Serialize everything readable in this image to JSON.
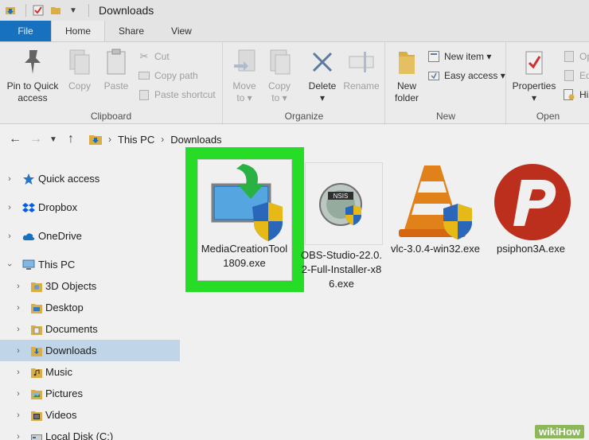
{
  "window": {
    "title": "Downloads"
  },
  "ribbon_tabs": [
    {
      "label": "File"
    },
    {
      "label": "Home"
    },
    {
      "label": "Share"
    },
    {
      "label": "View"
    }
  ],
  "ribbon": {
    "clipboard": {
      "label": "Clipboard",
      "pin_label": "Pin to Quick\naccess",
      "copy_label": "Copy",
      "paste_label": "Paste",
      "cut_label": "Cut",
      "copy_path_label": "Copy path",
      "paste_shortcut_label": "Paste shortcut"
    },
    "organize": {
      "label": "Organize",
      "move_to_label": "Move\nto ▾",
      "copy_to_label": "Copy\nto ▾",
      "delete_label": "Delete\n▾",
      "rename_label": "Rename"
    },
    "new": {
      "label": "New",
      "new_folder_label": "New\nfolder",
      "new_item_label": "New item ▾",
      "easy_access_label": "Easy access ▾"
    },
    "open": {
      "label": "Open",
      "properties_label": "Properties\n▾",
      "op_label": "Op",
      "edi_label": "Edi",
      "his_label": "His"
    }
  },
  "address": {
    "crumbs": [
      "This PC",
      "Downloads"
    ]
  },
  "sidebar": {
    "items": [
      {
        "label": "Quick access",
        "icon": "star-icon"
      },
      {
        "label": "Dropbox",
        "icon": "dropbox-icon"
      },
      {
        "label": "OneDrive",
        "icon": "cloud-icon"
      },
      {
        "label": "This PC",
        "icon": "computer-icon"
      },
      {
        "label": "3D Objects",
        "icon": "3d-objects-icon"
      },
      {
        "label": "Desktop",
        "icon": "desktop-icon"
      },
      {
        "label": "Documents",
        "icon": "documents-icon"
      },
      {
        "label": "Downloads",
        "icon": "downloads-icon"
      },
      {
        "label": "Music",
        "icon": "music-icon"
      },
      {
        "label": "Pictures",
        "icon": "pictures-icon"
      },
      {
        "label": "Videos",
        "icon": "videos-icon"
      },
      {
        "label": "Local Disk (C:)",
        "icon": "disk-icon"
      }
    ]
  },
  "files": [
    {
      "name": "MediaCreationTool1809.exe",
      "icon": "media-creation-tool-icon"
    },
    {
      "name": "OBS-Studio-22.0.2-Full-Installer-x86.exe",
      "icon": "obs-installer-icon"
    },
    {
      "name": "vlc-3.0.4-win32.exe",
      "icon": "vlc-icon"
    },
    {
      "name": "psiphon3A.exe",
      "icon": "psiphon-icon"
    }
  ],
  "colors": {
    "highlight": "#2aea2a",
    "file_tab": "#1979ca",
    "selected": "#cce4f7"
  },
  "watermark": "wikiHow"
}
